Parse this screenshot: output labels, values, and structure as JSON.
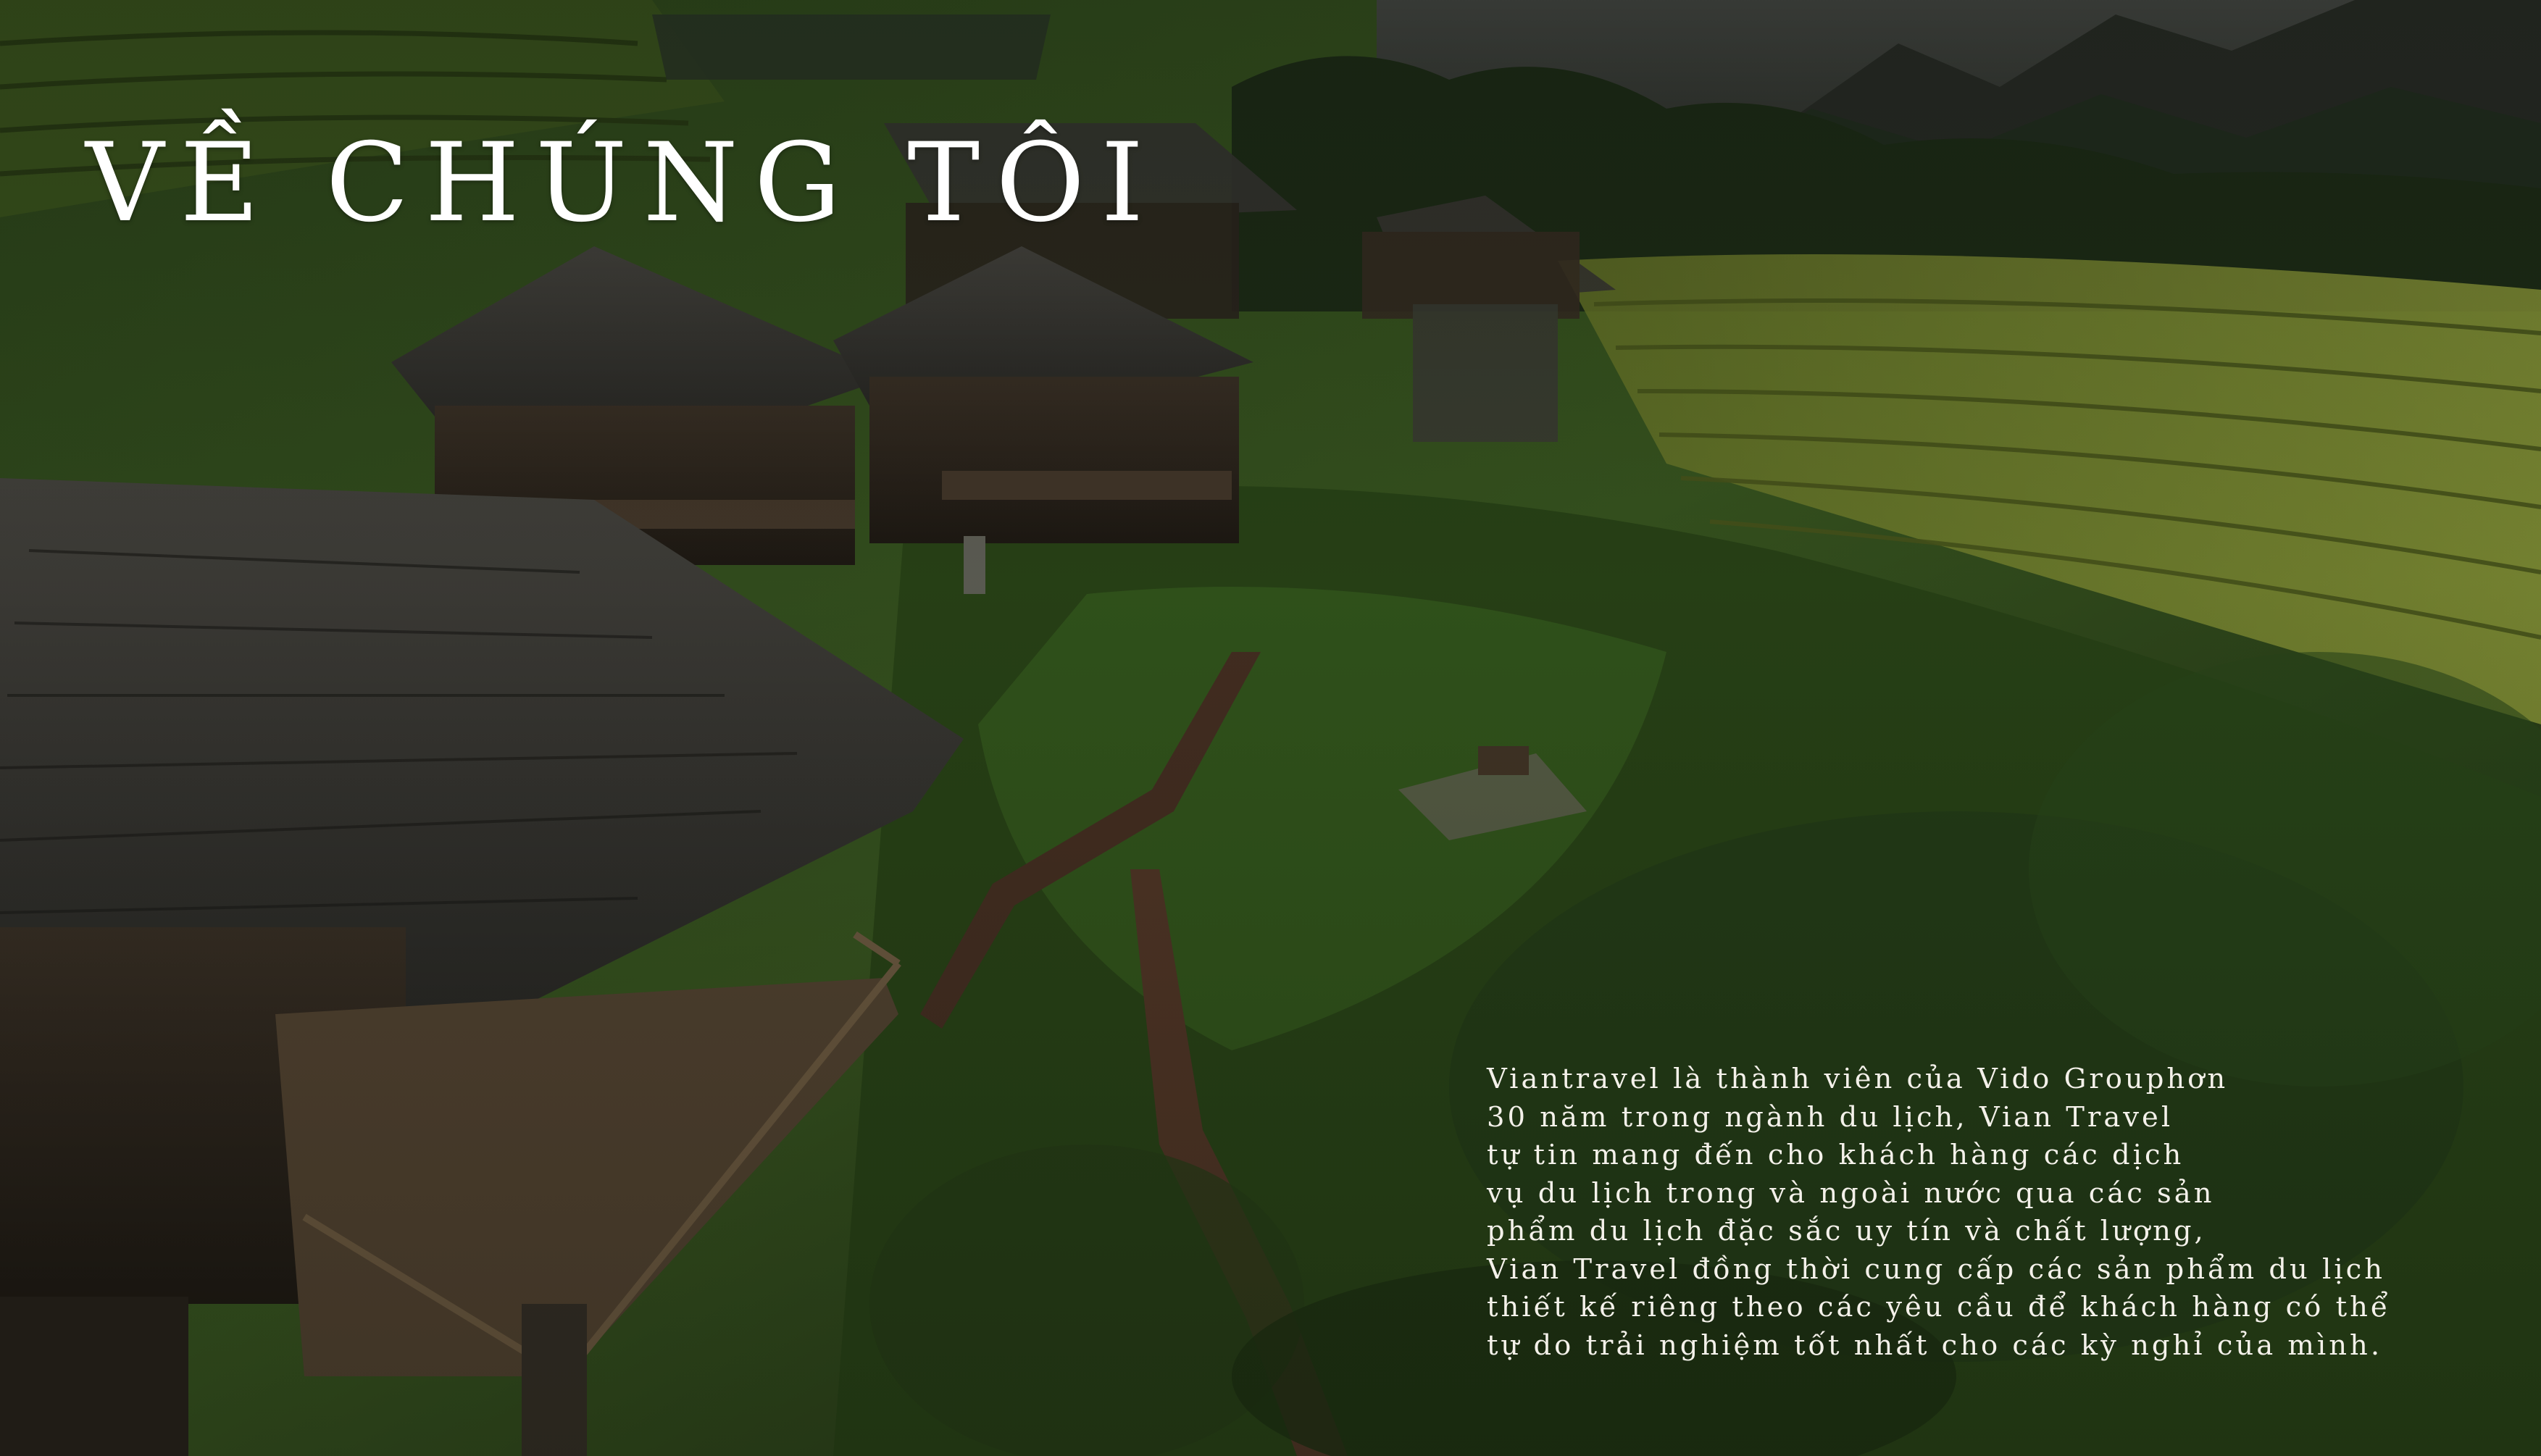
{
  "slide": {
    "title": "VỀ CHÚNG TÔI",
    "body_lines": [
      "Viantravel là thành viên của Vido Grouphơn",
      "30 năm trong ngành du lịch, Vian Travel",
      "tự tin mang đến cho khách hàng các dịch",
      "vụ du lịch trong và ngoài nước qua các sản",
      "phẩm du lịch đặc sắc uy tín và chất lượng,",
      "Vian Travel đồng thời cung cấp các sản phẩm du lịch",
      "thiết kế riêng theo các yêu cầu để khách hàng có thể",
      "tự do trải nghiệm tốt nhất cho các kỳ nghỉ của mình."
    ]
  }
}
